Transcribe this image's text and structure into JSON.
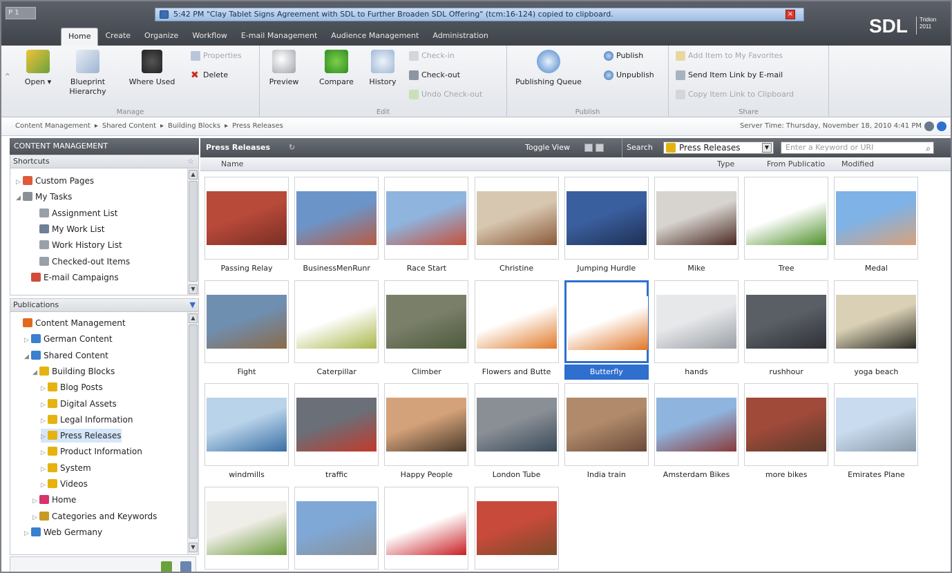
{
  "window": {
    "workspace_badge": "P 1"
  },
  "notification": {
    "text": "5:42 PM \"Clay Tablet Signs Agreement with SDL to Further Broaden SDL Offering\" (tcm:16-124) copied to clipboard.",
    "close": "×"
  },
  "brand": {
    "logo": "SDL",
    "product_line1": "Tridion",
    "product_line2": "2011"
  },
  "tabs": [
    "Home",
    "Create",
    "Organize",
    "Workflow",
    "E-mail Management",
    "Audience Management",
    "Administration"
  ],
  "ribbon": {
    "manage": {
      "label": "Manage",
      "open": "Open ▾",
      "blueprint": "Blueprint Hierarchy",
      "where_used": "Where Used",
      "properties": "Properties",
      "delete": "Delete"
    },
    "edit": {
      "label": "Edit",
      "preview": "Preview",
      "compare": "Compare",
      "history": "History",
      "check_in": "Check-in",
      "check_out": "Check-out",
      "undo": "Undo Check-out"
    },
    "publish": {
      "label": "Publish",
      "queue": "Publishing Queue",
      "publish": "Publish",
      "unpublish": "Unpublish"
    },
    "share": {
      "label": "Share",
      "fav": "Add Item to My Favorites",
      "email": "Send Item Link by E-mail",
      "copy": "Copy Item Link to Clipboard"
    }
  },
  "breadcrumb": [
    "Content Management",
    "▸",
    "Shared Content",
    "▸",
    "Building Blocks",
    "▸",
    "Press Releases"
  ],
  "server_time": "Server Time: Thursday, November 18, 2010 4:41 PM",
  "left": {
    "header": "CONTENT MANAGEMENT",
    "shortcuts_label": "Shortcuts",
    "shortcuts": [
      {
        "label": "Custom Pages",
        "toggle": "▷",
        "icon": "custom-pages-icon",
        "color": "#e05a3a",
        "level": 0
      },
      {
        "label": "My Tasks",
        "toggle": "◢",
        "icon": "tasks-icon",
        "color": "#8b8f96",
        "level": 0
      },
      {
        "label": "Assignment List",
        "toggle": "",
        "icon": "list-icon",
        "color": "#9aa0a8",
        "level": 2
      },
      {
        "label": "My Work List",
        "toggle": "",
        "icon": "list-icon",
        "color": "#6d7f99",
        "level": 2
      },
      {
        "label": "Work History List",
        "toggle": "",
        "icon": "history-icon",
        "color": "#9aa0a8",
        "level": 2
      },
      {
        "label": "Checked-out Items",
        "toggle": "",
        "icon": "checkout-icon",
        "color": "#9aa0a8",
        "level": 2
      },
      {
        "label": "E-mail Campaigns",
        "toggle": "",
        "icon": "email-campaign-icon",
        "color": "#d24c3c",
        "level": 1
      }
    ],
    "publications_label": "Publications",
    "publications": [
      {
        "label": "Content Management",
        "toggle": "",
        "icon": "cm-icon",
        "color": "#e06a1c",
        "level": 0
      },
      {
        "label": "German Content",
        "toggle": "▷",
        "icon": "publication-icon",
        "color": "#3a7fd0",
        "level": 1
      },
      {
        "label": "Shared Content",
        "toggle": "◢",
        "icon": "publication-icon",
        "color": "#3a7fd0",
        "level": 1
      },
      {
        "label": "Building Blocks",
        "toggle": "◢",
        "icon": "folder-icon",
        "color": "#e4b30f",
        "level": 2
      },
      {
        "label": "Blog Posts",
        "toggle": "▷",
        "icon": "folder-icon",
        "color": "#e4b30f",
        "level": 3
      },
      {
        "label": "Digital Assets",
        "toggle": "▷",
        "icon": "folder-icon",
        "color": "#e4b30f",
        "level": 3
      },
      {
        "label": "Legal Information",
        "toggle": "▷",
        "icon": "folder-icon",
        "color": "#e4b30f",
        "level": 3
      },
      {
        "label": "Press Releases",
        "toggle": "▷",
        "icon": "folder-icon",
        "color": "#e4b30f",
        "level": 3
      },
      {
        "label": "Product Information",
        "toggle": "▷",
        "icon": "folder-icon",
        "color": "#e4b30f",
        "level": 3
      },
      {
        "label": "System",
        "toggle": "▷",
        "icon": "folder-icon",
        "color": "#e4b30f",
        "level": 3
      },
      {
        "label": "Videos",
        "toggle": "▷",
        "icon": "folder-icon",
        "color": "#e4b30f",
        "level": 3
      },
      {
        "label": "Home",
        "toggle": "▷",
        "icon": "home-icon",
        "color": "#d8336b",
        "level": 2
      },
      {
        "label": "Categories and Keywords",
        "toggle": "▷",
        "icon": "categories-icon",
        "color": "#c69a25",
        "level": 2
      },
      {
        "label": "Web Germany",
        "toggle": "▷",
        "icon": "publication-icon",
        "color": "#3a7fd0",
        "level": 1
      }
    ]
  },
  "main": {
    "title": "Press Releases",
    "refresh": "↻",
    "toggle_view": "Toggle View",
    "search_label": "Search",
    "scope": "Press Releases",
    "keyword_placeholder": "Enter a Keyword or URI",
    "columns": {
      "name": "Name",
      "type": "Type",
      "from": "From Publicatio",
      "modified": "Modified"
    },
    "items": [
      {
        "name": "Passing Relay",
        "c1": "#b84a3a",
        "c2": "#7a2e24"
      },
      {
        "name": "BusinessMenRunr",
        "c1": "#6b95c9",
        "c2": "#b85a42"
      },
      {
        "name": "Race Start",
        "c1": "#8fb4de",
        "c2": "#c4503c"
      },
      {
        "name": "Christine",
        "c1": "#d8c7b0",
        "c2": "#8a5a3a"
      },
      {
        "name": "Jumping Hurdle",
        "c1": "#3a5f9e",
        "c2": "#1f2f55"
      },
      {
        "name": "Mike",
        "c1": "#d7d3cf",
        "c2": "#4a2a22"
      },
      {
        "name": "Tree",
        "c1": "#ffffff",
        "c2": "#4f8f2a"
      },
      {
        "name": "Medal",
        "c1": "#7fb2e6",
        "c2": "#d8a27a"
      },
      {
        "name": "Fight",
        "c1": "#6f8fb0",
        "c2": "#8a6a4a"
      },
      {
        "name": "Caterpillar",
        "c1": "#ffffff",
        "c2": "#a9b64a"
      },
      {
        "name": "Climber",
        "c1": "#7a7f6a",
        "c2": "#4d5a3a"
      },
      {
        "name": "Flowers and Butte",
        "c1": "#ffffff",
        "c2": "#e07a2a"
      },
      {
        "name": "Butterfly",
        "c1": "#ffffff",
        "c2": "#e0762a"
      },
      {
        "name": "hands",
        "c1": "#e6e8ea",
        "c2": "#9a9ea4"
      },
      {
        "name": "rushhour",
        "c1": "#5a5f66",
        "c2": "#2e3035"
      },
      {
        "name": "yoga beach",
        "c1": "#d9d0b5",
        "c2": "#2a2a22"
      },
      {
        "name": "windmills",
        "c1": "#b9d3ea",
        "c2": "#3a6fa3"
      },
      {
        "name": "traffic",
        "c1": "#6a6f78",
        "c2": "#c23a2a"
      },
      {
        "name": "Happy People",
        "c1": "#d4a27a",
        "c2": "#4a3a2a"
      },
      {
        "name": "London Tube",
        "c1": "#8a8f96",
        "c2": "#3a4a5a"
      },
      {
        "name": "India train",
        "c1": "#b08a6a",
        "c2": "#6a4a3a"
      },
      {
        "name": "Amsterdam Bikes",
        "c1": "#8fb4de",
        "c2": "#8a3a3a"
      },
      {
        "name": "more bikes",
        "c1": "#a04a3a",
        "c2": "#5a3a2a"
      },
      {
        "name": "Emirates Plane",
        "c1": "#c9dbee",
        "c2": "#8a9aaa"
      },
      {
        "name": "",
        "c1": "#f0eee8",
        "c2": "#6a9a3a"
      },
      {
        "name": "",
        "c1": "#7fa8d6",
        "c2": "#8a8f96"
      },
      {
        "name": "",
        "c1": "#ffffff",
        "c2": "#c81e24"
      },
      {
        "name": "",
        "c1": "#c84a3a",
        "c2": "#7a4a2a"
      }
    ],
    "selected_index": 12
  },
  "colors": {
    "accent": "#2f6fce",
    "header": "#4d5158",
    "folder": "#e4b30f"
  }
}
